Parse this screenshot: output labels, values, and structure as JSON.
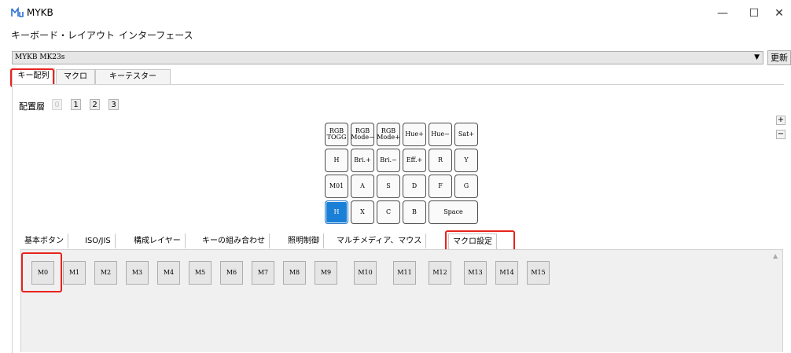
{
  "window": {
    "title": "MYKB",
    "controls": {
      "minimize": "—",
      "maximize": "☐",
      "close": "✕"
    }
  },
  "menubar": [
    "キーボード・レイアウト",
    "インターフェース"
  ],
  "device": {
    "selected": "MYKB MK23s",
    "refresh_label": "更新"
  },
  "top_tabs": [
    "キー配列",
    "マクロ",
    "キーテスター"
  ],
  "layer": {
    "label": "配置層",
    "layers": [
      "0",
      "1",
      "2",
      "3"
    ],
    "active": 0
  },
  "zoom": {
    "plus": "+",
    "minus": "−"
  },
  "keymap": {
    "rows": [
      [
        "RGB TOGG",
        "RGB Mode−",
        "RGB Mode+",
        "Hue+",
        "Hue−",
        "Sat+"
      ],
      [
        "H",
        "Bri.+",
        "Bri.−",
        "Eff.+",
        "R",
        "Y"
      ],
      [
        "M01",
        "A",
        "S",
        "D",
        "F",
        "G"
      ],
      [
        "H",
        "X",
        "C",
        "B",
        "Space"
      ]
    ],
    "selected_key": "H"
  },
  "category_tabs": [
    "基本ボタン",
    "ISO/JIS",
    "構成レイヤー",
    "キーの組み合わせ",
    "照明制御",
    "マルチメディア、マウス",
    "マクロ設定"
  ],
  "active_category": "マクロ設定",
  "macros": [
    "M0",
    "M1",
    "M2",
    "M3",
    "M4",
    "M5",
    "M6",
    "M7",
    "M8",
    "M9",
    "M10",
    "M11",
    "M12",
    "M13",
    "M14",
    "M15"
  ],
  "highlight_color": "#e8231c",
  "accent_color": "#1a7fd6"
}
